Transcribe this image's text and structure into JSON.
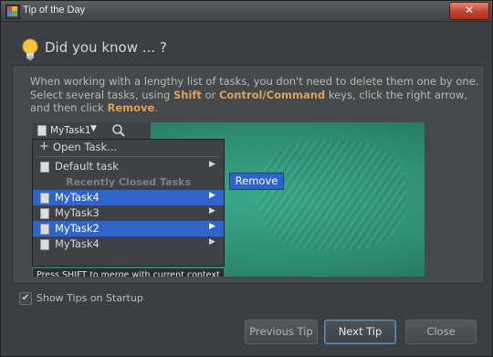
{
  "window": {
    "title": "Tip of the Day",
    "close_glyph": "✕"
  },
  "header": {
    "heading": "Did you know ... ?",
    "icon": "lightbulb-icon"
  },
  "tip": {
    "line1": "When working with a lengthy list of tasks, you don't need to delete them one by one.",
    "line2_pre": "Select several tasks, using ",
    "line2_shift": "Shift",
    "line2_or": " or ",
    "line2_keys": "Control/Command",
    "line2_post": " keys, click the right arrow,",
    "line3_pre": "and then click ",
    "line3_remove": "Remove",
    "line3_post": "."
  },
  "illustration": {
    "task_selector": "MyTask1",
    "open_task": "Open Task...",
    "default_task": "Default task",
    "recent_header": "Recently Closed Tasks",
    "tasks": [
      {
        "label": "MyTask4",
        "selected": true
      },
      {
        "label": "MyTask3",
        "selected": false
      },
      {
        "label": "MyTask2",
        "selected": true
      },
      {
        "label": "MyTask4",
        "selected": false
      }
    ],
    "hint": "Press SHIFT to merge with current context",
    "remove_label": "Remove"
  },
  "options": {
    "show_tips_label": "Show Tips on Startup",
    "show_tips_checked": true,
    "check_glyph": "✔"
  },
  "buttons": {
    "previous": "Previous Tip",
    "next": "Next Tip",
    "close": "Close"
  },
  "colors": {
    "background": "#3c3f41",
    "highlight": "#e1a05a",
    "selection": "#2f65ca"
  }
}
